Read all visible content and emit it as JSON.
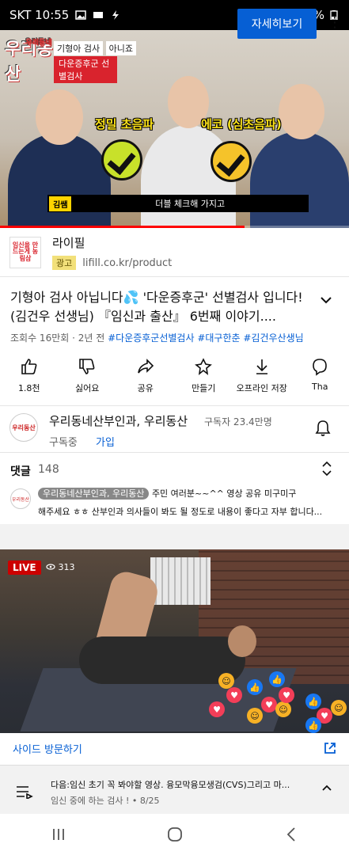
{
  "status_bar": {
    "carrier_time": "SKT 10:55",
    "battery": "21%"
  },
  "video": {
    "logo": "우리동산",
    "logo_top": "우리동네",
    "banner_line1": "기형아 검사",
    "banner_badge": "아니죠",
    "banner_line2": "다운증후군 선별검사",
    "label_left": "정밀 초음파",
    "label_right": "에코 (심초음파)",
    "caption_tag": "김쌤",
    "caption": "더블 체크해 가지고",
    "progress": 0.7
  },
  "ad": {
    "logo_text": "임신을 만드는게 농림삼",
    "title": "라이필",
    "badge": "광고",
    "url": "lifill.co.kr/product",
    "cta": "자세히보기",
    "menu": "⋮"
  },
  "video_info": {
    "title": "기형아 검사 아닙니다💦 '다운증후군' 선별검사 입니다!(김건우 선생님) 『임신과 출산』 6번째 이야기....",
    "views": "조회수 16만회 · 2년 전",
    "tags": "#다운증후군선별검사 #대구한춘 #김건우산생님"
  },
  "actions": [
    {
      "label": "1.8천",
      "icon": "like-icon"
    },
    {
      "label": "싫어요",
      "icon": "dislike-icon"
    },
    {
      "label": "공유",
      "icon": "share-icon"
    },
    {
      "label": "만들기",
      "icon": "remix-icon"
    },
    {
      "label": "오프라인 저장",
      "icon": "download-icon"
    },
    {
      "label": "Tha",
      "icon": "thanks-icon"
    }
  ],
  "channel": {
    "avatar_text": "우리동산",
    "name": "우리동네산부인과, 우리동산",
    "subscribers": "구독자 23.4만명",
    "status": "구독중",
    "join": "가입"
  },
  "comments": {
    "title": "댓글",
    "count": "148",
    "author": "우리동네산부인과, 우리동산",
    "text_line1": "주민 여러분~~^^ 영상 공유 미구미구",
    "text_line2": "해주세요 ㅎㅎ 산부인과 의사들이 봐도 될 정도로 내용이 좋다고 자부 합니다..."
  },
  "live_card": {
    "badge": "LIVE",
    "viewers": "313",
    "visit": "사이드 방문하기"
  },
  "up_next": {
    "title": "다음:임신 초기 꼭 봐야할 영상. 융모막융모생검(CVS)그리고 마...",
    "subtitle": "임신 중에 하는 검사 ! • 8/25"
  },
  "nav": {
    "recents": "|||",
    "home": "○",
    "back": "‹"
  }
}
